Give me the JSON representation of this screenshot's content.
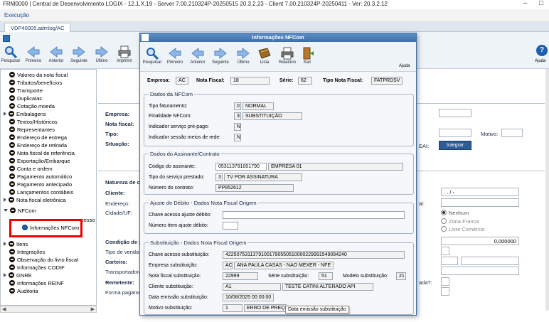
{
  "window": {
    "title": "FRM0000 | Central de Desenvolvimento LOGIX - 12.1.X.19 - Server 7.00.210324P-20250515 20.3.2.23 - Client 7.00.210324P-20250411 - Ver: 20.3.2.12",
    "minimize": "–",
    "restore": "□"
  },
  "menu": {
    "execucao": "Execução"
  },
  "tab": {
    "label": "VDP40005.admlog/AC"
  },
  "toolbar": {
    "pesquisar": "Pesquisar",
    "primeiro": "Primeiro",
    "anterior": "Anterior",
    "seguinte": "Seguinte",
    "ultimo": "Último",
    "imprimir": "Imprimir",
    "lista": "Lista",
    "relatorio": "Relatório",
    "sair": "Sair",
    "ajuda": "Ajuda"
  },
  "tree": {
    "items": [
      {
        "label": "Valores da nota fiscal"
      },
      {
        "label": "Tributos/benefícios"
      },
      {
        "label": "Transporte"
      },
      {
        "label": "Duplicatas"
      },
      {
        "label": "Cotação moeda"
      },
      {
        "label": "Embalagens"
      },
      {
        "label": "Textos/Históricos"
      },
      {
        "label": "Representantes"
      },
      {
        "label": "Endereço de entrega"
      },
      {
        "label": "Endereço de retirada"
      },
      {
        "label": "Nota fiscal de referência"
      },
      {
        "label": "Exportação/Embarque"
      },
      {
        "label": "Conta e ordem"
      },
      {
        "label": "Pagamento automático"
      },
      {
        "label": "Pagamento antecipado"
      },
      {
        "label": "Lançamentos contábeis"
      },
      {
        "label": "Nota fiscal eletrônica"
      },
      {
        "label": "NFCom"
      },
      {
        "label": "Informações NFCom"
      },
      {
        "label": "Itens"
      },
      {
        "label": "Integrações"
      },
      {
        "label": "Observação do livro fiscal"
      },
      {
        "label": "Informações CODIF"
      },
      {
        "label": "GNRE"
      },
      {
        "label": "Informações REINF"
      },
      {
        "label": "Auditoria"
      }
    ],
    "partial_text": "cesso"
  },
  "background": {
    "empresa": "Empresa:",
    "nota_fiscal": "Nota fiscal:",
    "tipo": "Tipo:",
    "situacao": "Situação:",
    "natureza": "Natureza de op",
    "cliente": "Cliente:",
    "endereco": "Endereço:",
    "cidade_uf": "Cidade/UF:",
    "condicao": "Condição de pa",
    "tipo_venda": "Tipo de venda:",
    "carteira": "Carteira:",
    "transportadora": "Transportadora",
    "remetente": "Remetente:",
    "forma_pagamento": "Forma pagamen",
    "motivo": "Motivo:",
    "eai": "EAI:",
    "integrar": "Integrar",
    "date_mask": ". . / -",
    "al": "al:",
    "value": "0,000000",
    "cada": "ada?:",
    "radio_nenhum": "Nenhum",
    "radio_zona": "Zona Franca",
    "radio_livre": "Livre Comércio"
  },
  "modal": {
    "title": "Informações NFCom",
    "empresa_label": "Empresa:",
    "empresa": "AC",
    "nota_label": "Nota Fiscal:",
    "nota": "18",
    "serie_label": "Série:",
    "serie": "62",
    "tipo_label": "Tipo Nota Fiscal:",
    "tipo": "FATPRDSV",
    "dados_nfcom": {
      "title": "Dados da NFCom",
      "tipo_fat_label": "Tipo faturamento:",
      "tipo_fat_code": "0",
      "tipo_fat": "NORMAL",
      "finalidade_label": "Finalidade NFCom:",
      "finalidade_code": "3",
      "finalidade": "SUBSTITUIÇÃO",
      "pre_pago_label": "Indicador serviço pré-pago:",
      "pre_pago": "N",
      "sessao_label": "Indicador sessão meios de rede:",
      "sessao": "N"
    },
    "assinante": {
      "title": "Dados do Assinante/Contrato",
      "codigo_label": "Código do assinante:",
      "codigo": "053113791001790",
      "codigo_nome": "EMPRESA 01",
      "tipo_servico_label": "Tipo do serviço prestado:",
      "tipo_servico_code": "3",
      "tipo_servico": "TV POR ASSINATURA",
      "contrato_label": "Número do contrato:",
      "contrato": "PP852612"
    },
    "ajuste": {
      "title": "Ajuste de Débito - Dados Nota Fiscal Origem",
      "chave_label": "Chave acesso ajuste débito:",
      "item_label": "Número item ajuste débito:"
    },
    "substituicao": {
      "title": "Substituição - Dados Nota Fiscal Origem",
      "chave_label": "Chave acesso substituição:",
      "chave": "42250753113791001790550510000229991549094240",
      "empresa_label": "Empresa substituição:",
      "empresa_code": "AC",
      "empresa": "ANA PAULA CASAS - NAO MEXER - NFE",
      "nota_label": "Nota fiscal substituição:",
      "nota": "22999",
      "serie_label": "Série substituição:",
      "serie": "51",
      "modelo_label": "Modelo substituição:",
      "modelo": "21",
      "cliente_label": "Cliente substituição:",
      "cliente_code": "A1",
      "cliente": "TESTE CATINI ALTERADO API",
      "data_label": "Data emissão substituição:",
      "data": "10/08/2025 00:00:00",
      "motivo_label": "Motivo substituição:",
      "motivo_code": "1",
      "motivo": "ERRO DE PREÇO"
    },
    "tooltip": "Data emissão substituição"
  },
  "colors": {
    "accent": "#3d6fa8",
    "highlight": "#e00000"
  }
}
